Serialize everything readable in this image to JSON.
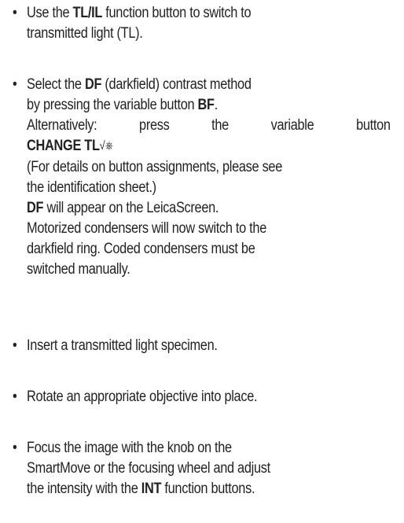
{
  "bullet_symbol": "•",
  "step1": {
    "l1a": "Use the ",
    "l1b": "TL/IL",
    "l1c": " function button to switch to",
    "l2": "transmitted light (TL)."
  },
  "step2": {
    "l1a": "Select the ",
    "l1b": "DF",
    "l1c": " (darkfield) contrast method",
    "l2a": "by pressing the variable button ",
    "l2b": "BF",
    "l2c": ".",
    "l3_w1": "Alternatively:",
    "l3_w2": "press",
    "l3_w3": "the",
    "l3_w4": "variable",
    "l3_w5": "button",
    "l4a": "CHANGE TL",
    "l4_icon": "√⎈",
    "l5": "(For details on button assignments, please see",
    "l6": "the identification sheet.)",
    "l7a": "DF",
    "l7b": " will appear on the LeicaScreen.",
    "l8": "Motorized condensers will now switch to the",
    "l9": "darkfield ring. Coded condensers must be",
    "l10": "switched manually."
  },
  "step3": {
    "l1": "Insert a transmitted light specimen."
  },
  "step4": {
    "l1": "Rotate an appropriate objective into place."
  },
  "step5": {
    "l1": "Focus the image with the knob on the",
    "l2": "SmartMove or the focusing wheel and adjust",
    "l3a": "the intensity with the ",
    "l3b": "INT",
    "l3c": " function buttons."
  }
}
